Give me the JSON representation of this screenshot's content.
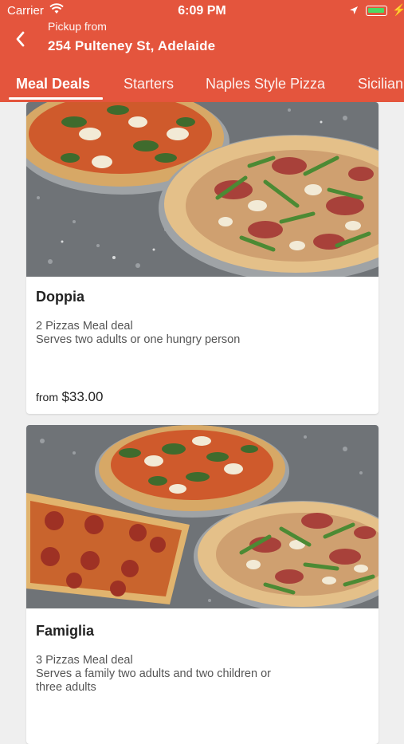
{
  "status_bar": {
    "carrier": "Carrier",
    "time": "6:09 PM"
  },
  "header": {
    "pickup_label": "Pickup from",
    "address": "254 Pulteney St, Adelaide"
  },
  "tabs": [
    {
      "label": "Meal Deals",
      "active": true
    },
    {
      "label": "Starters"
    },
    {
      "label": "Naples Style Pizza"
    },
    {
      "label": "Sicilian"
    }
  ],
  "deals": [
    {
      "title": "Doppia",
      "desc_line1": "2 Pizzas Meal deal",
      "desc_line2": "Serves two adults or one hungry person",
      "price_prefix": "from",
      "price": "$33.00"
    },
    {
      "title": "Famiglia",
      "desc_line1": "3 Pizzas Meal deal",
      "desc_line2": "Serves a family two adults and two children or three adults"
    }
  ],
  "colors": {
    "header": "#e4553d",
    "background": "#efefef",
    "battery": "#4cd964"
  }
}
